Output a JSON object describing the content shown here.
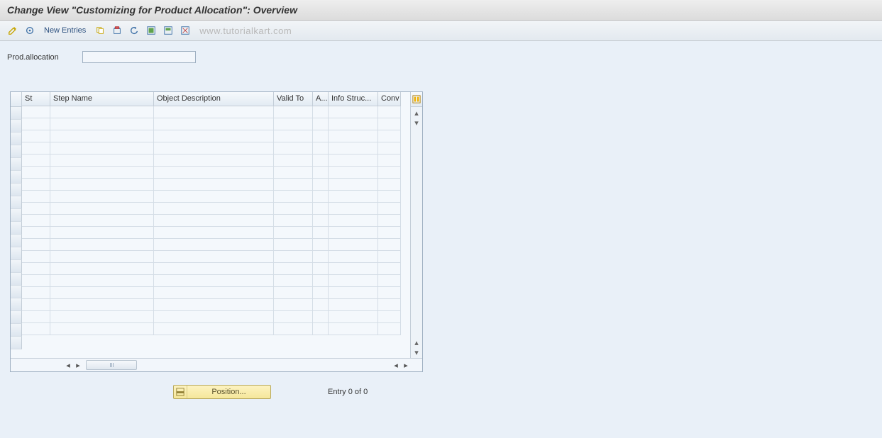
{
  "title": "Change View \"Customizing for Product Allocation\": Overview",
  "toolbar": {
    "new_entries_label": "New Entries"
  },
  "watermark": "www.tutorialkart.com",
  "fields": {
    "prod_allocation_label": "Prod.allocation",
    "prod_allocation_value": ""
  },
  "table": {
    "columns": {
      "st": "St",
      "step_name": "Step Name",
      "object_description": "Object Description",
      "valid_to": "Valid To",
      "a": "A...",
      "info_struc": "Info Struc...",
      "conv": "Conv"
    },
    "row_count": 19
  },
  "footer": {
    "position_label": "Position...",
    "entry_text": "Entry 0 of 0"
  },
  "icons": {
    "change": "change-icon",
    "display": "display-icon",
    "copy": "copy-icon",
    "delete": "delete-icon",
    "undo": "undo-icon",
    "select_all": "select-all-icon",
    "deselect_all": "deselect-all-icon",
    "print": "print-icon",
    "configure": "table-settings-icon",
    "position": "position-icon"
  }
}
